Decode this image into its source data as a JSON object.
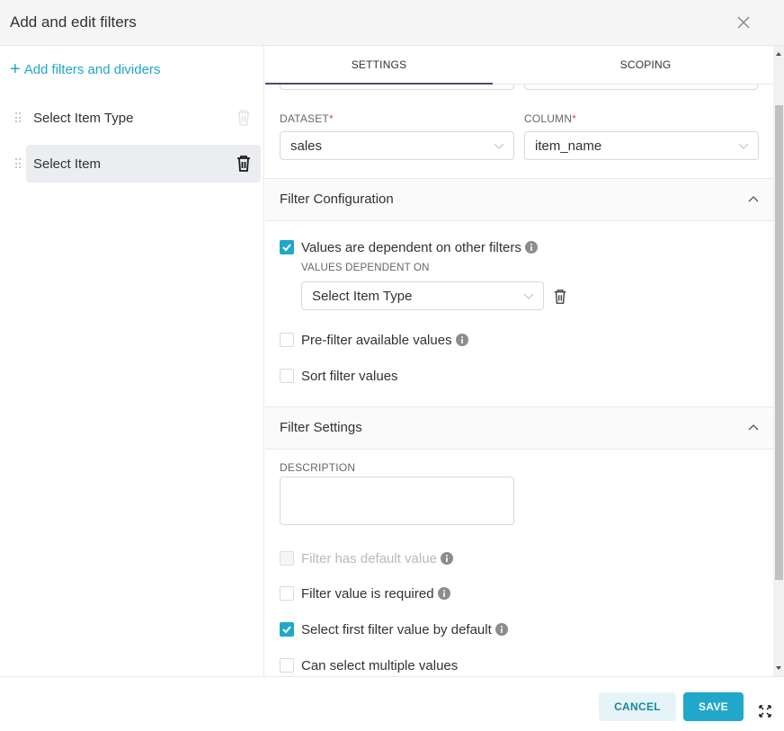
{
  "header": {
    "title": "Add and edit filters",
    "close_label": "×"
  },
  "sidebar": {
    "add_label": "Add filters and dividers",
    "add_icon": "+",
    "items": [
      {
        "label": "Select Item Type",
        "active": false
      },
      {
        "label": "Select Item",
        "active": true
      }
    ]
  },
  "tabs": [
    {
      "label": "SETTINGS",
      "active": true
    },
    {
      "label": "SCOPING",
      "active": false
    }
  ],
  "fields": {
    "dataset": {
      "label": "DATASET",
      "required_mark": "*",
      "value": "sales"
    },
    "column": {
      "label": "COLUMN",
      "required_mark": "*",
      "value": "item_name"
    }
  },
  "filter_configuration": {
    "title": "Filter Configuration",
    "dependent": {
      "label": "Values are dependent on other filters",
      "checked": true
    },
    "dependent_on_label": "VALUES DEPENDENT ON",
    "dependent_on_value": "Select Item Type",
    "prefilter": {
      "label": "Pre-filter available values",
      "checked": false
    },
    "sort": {
      "label": "Sort filter values",
      "checked": false
    }
  },
  "filter_settings": {
    "title": "Filter Settings",
    "description_label": "DESCRIPTION",
    "description_value": "",
    "has_default": {
      "label": "Filter has default value",
      "checked": false,
      "disabled": true
    },
    "required": {
      "label": "Filter value is required",
      "checked": false
    },
    "select_first": {
      "label": "Select first filter value by default",
      "checked": true
    },
    "multiple": {
      "label": "Can select multiple values",
      "checked": false
    }
  },
  "footer": {
    "cancel_label": "CANCEL",
    "save_label": "SAVE"
  },
  "colors": {
    "accent": "#20a7c9",
    "tab_indicator": "#484d6e",
    "required": "#e04355"
  }
}
